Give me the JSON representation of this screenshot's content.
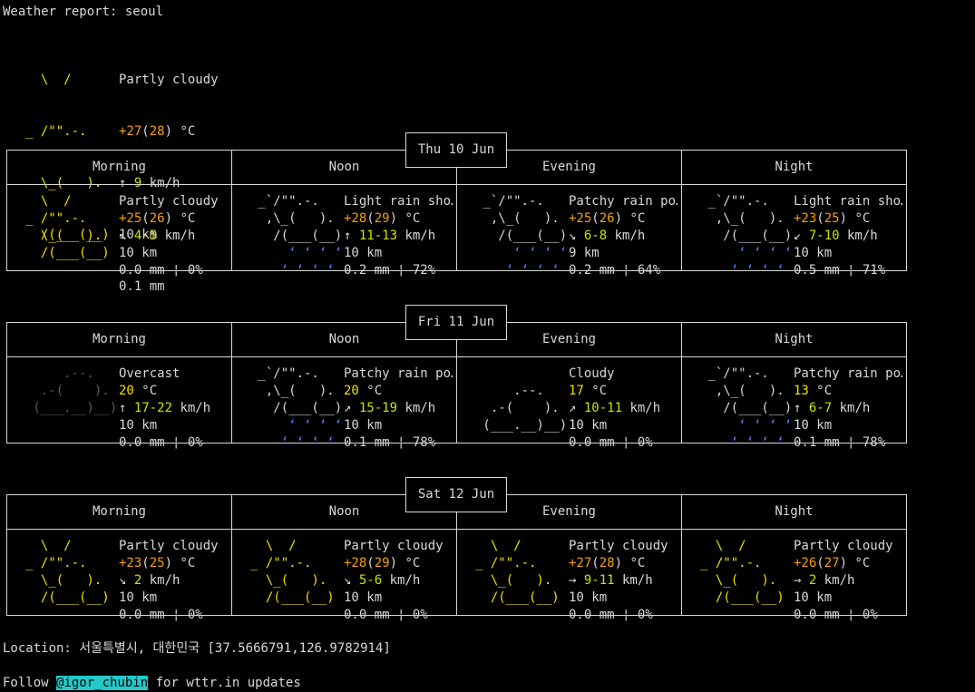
{
  "header": {
    "title": "Weather report: seoul"
  },
  "current": {
    "art": [
      "  \\  /      ",
      "_ /\"\".-.    ",
      "  \\_(   ).  ",
      "  /(___(__) "
    ],
    "art_color": "#f0e000",
    "condition": "Partly cloudy",
    "temp": "+27",
    "feels": "28",
    "temp_unit": " °C",
    "wind_arrow": "↑ ",
    "wind_speed": "9",
    "wind_unit": " km/h",
    "visibility": "10 km",
    "precip": "0.1 mm"
  },
  "days": [
    {
      "date": "Thu 10 Jun",
      "periods": [
        {
          "label": "Morning",
          "art_kind": "sun",
          "condition": "Partly cloudy",
          "temp": "+25",
          "feels": "26",
          "wind_arrow": "↖ ",
          "wind_speed": "4-5",
          "visibility": "10 km",
          "precip": "0.0 mm ¦ 0%"
        },
        {
          "label": "Noon",
          "art_kind": "rain",
          "condition": "Light rain sho…",
          "temp": "+28",
          "feels": "29",
          "wind_arrow": "↑ ",
          "wind_speed": "11-13",
          "visibility": "10 km",
          "precip": "0.2 mm ¦ 72%"
        },
        {
          "label": "Evening",
          "art_kind": "rain",
          "condition": "Patchy rain po…",
          "temp": "+25",
          "feels": "26",
          "wind_arrow": "↘ ",
          "wind_speed": "6-8",
          "visibility": "9 km",
          "precip": "0.2 mm ¦ 64%"
        },
        {
          "label": "Night",
          "art_kind": "rain",
          "condition": "Light rain sho…",
          "temp": "+23",
          "feels": "25",
          "wind_arrow": "↙ ",
          "wind_speed": "7-10",
          "visibility": "10 km",
          "precip": "0.5 mm ¦ 71%"
        }
      ]
    },
    {
      "date": "Fri 11 Jun",
      "periods": [
        {
          "label": "Morning",
          "art_kind": "overcast",
          "condition": "Overcast",
          "temp": "20",
          "feels": "",
          "wind_arrow": "↑ ",
          "wind_speed": "17-22",
          "visibility": "10 km",
          "precip": "0.0 mm ¦ 0%"
        },
        {
          "label": "Noon",
          "art_kind": "rain",
          "condition": "Patchy rain po…",
          "temp": "20",
          "feels": "",
          "wind_arrow": "↗ ",
          "wind_speed": "15-19",
          "visibility": "10 km",
          "precip": "0.1 mm ¦ 78%"
        },
        {
          "label": "Evening",
          "art_kind": "cloud",
          "condition": "Cloudy",
          "temp": "17",
          "feels": "",
          "wind_arrow": "↗ ",
          "wind_speed": "10-11",
          "visibility": "10 km",
          "precip": "0.0 mm ¦ 0%"
        },
        {
          "label": "Night",
          "art_kind": "rain",
          "condition": "Patchy rain po…",
          "temp": "13",
          "feels": "",
          "wind_arrow": "↑ ",
          "wind_speed": "6-7",
          "visibility": "10 km",
          "precip": "0.1 mm ¦ 78%"
        }
      ]
    },
    {
      "date": "Sat 12 Jun",
      "periods": [
        {
          "label": "Morning",
          "art_kind": "sun",
          "condition": "Partly cloudy",
          "temp": "+23",
          "feels": "25",
          "wind_arrow": "↘ ",
          "wind_speed": "2",
          "visibility": "10 km",
          "precip": "0.0 mm ¦ 0%"
        },
        {
          "label": "Noon",
          "art_kind": "sun",
          "condition": "Partly cloudy",
          "temp": "+28",
          "feels": "29",
          "wind_arrow": "↘ ",
          "wind_speed": "5-6",
          "visibility": "10 km",
          "precip": "0.0 mm ¦ 0%"
        },
        {
          "label": "Evening",
          "art_kind": "sun",
          "condition": "Partly cloudy",
          "temp": "+27",
          "feels": "28",
          "wind_arrow": "→ ",
          "wind_speed": "9-11",
          "visibility": "10 km",
          "precip": "0.0 mm ¦ 0%"
        },
        {
          "label": "Night",
          "art_kind": "sun",
          "condition": "Partly cloudy",
          "temp": "+26",
          "feels": "27",
          "wind_arrow": "→ ",
          "wind_speed": "2",
          "visibility": "10 km",
          "precip": "0.0 mm ¦ 0%"
        }
      ]
    }
  ],
  "art_templates": {
    "sun": [
      "  \\  /      ",
      "_ /\"\".-.    ",
      "  \\_(   ).  ",
      "  /(___(__) ",
      ""
    ],
    "rain": [
      " _`/\"\".-.   ",
      "  ,\\_(   ). ",
      "   /(___(__)",
      "     ʻ ʻ ʻ ʻ",
      "    ʻ ʻ ʻ ʻ "
    ],
    "overcast": [
      "     .--.   ",
      "  .-(    ). ",
      " (___.__)__)",
      "",
      ""
    ],
    "cloud": [
      "            ",
      "     .--.   ",
      "  .-(    ). ",
      " (___.__)__)",
      ""
    ]
  },
  "footer": {
    "location_label": "Location: ",
    "location_value": "서울특별시, 대한민국 [37.5666791,126.9782914]",
    "follow_prefix": "Follow ",
    "handle": "@igor_chubin",
    "follow_suffix": " for wttr.in updates"
  }
}
